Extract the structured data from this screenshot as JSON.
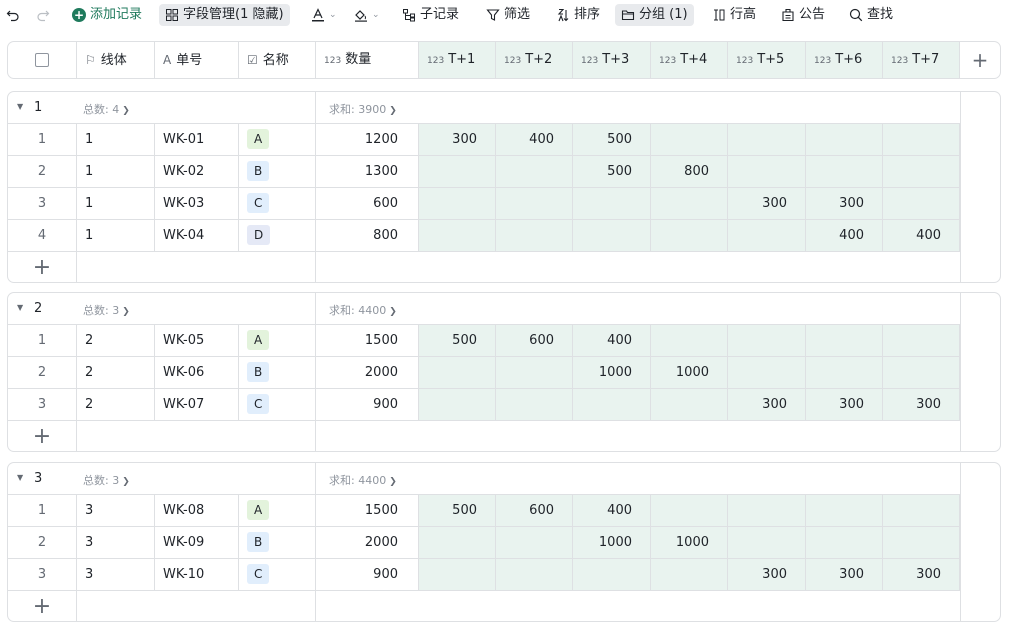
{
  "toolbar": {
    "undo_icon": "undo-icon",
    "redo_icon": "redo-icon",
    "add_record": "添加记录",
    "field_manage": "字段管理(1 隐藏)",
    "sub_record": "子记录",
    "filter": "筛选",
    "sort": "排序",
    "group": "分组 (1)",
    "row_height": "行高",
    "notice": "公告",
    "search": "查找"
  },
  "columns": {
    "line": "线体",
    "order_no": "单号",
    "name": "名称",
    "qty": "数量",
    "num_prefix": "123",
    "t1": "T+1",
    "t2": "T+2",
    "t3": "T+3",
    "t4": "T+4",
    "t5": "T+5",
    "t6": "T+6",
    "t7": "T+7"
  },
  "colors": {
    "accent_green": "#1f7a5c",
    "tinted_bg": "#e9f3ef",
    "tag_A": "#e3f3dc",
    "tag_B": "#e1eefc",
    "tag_C": "#e1eefc",
    "tag_D": "#e5e9f6"
  },
  "groups": [
    {
      "label": "1",
      "count": "总数: 4",
      "sum": "求和: 3900",
      "rows": [
        {
          "idx": "1",
          "line": "1",
          "order": "WK-01",
          "name": "A",
          "qty": "1200",
          "t": [
            "300",
            "400",
            "500",
            "",
            "",
            "",
            ""
          ]
        },
        {
          "idx": "2",
          "line": "1",
          "order": "WK-02",
          "name": "B",
          "qty": "1300",
          "t": [
            "",
            "",
            "500",
            "800",
            "",
            "",
            ""
          ]
        },
        {
          "idx": "3",
          "line": "1",
          "order": "WK-03",
          "name": "C",
          "qty": "600",
          "t": [
            "",
            "",
            "",
            "",
            "300",
            "300",
            ""
          ]
        },
        {
          "idx": "4",
          "line": "1",
          "order": "WK-04",
          "name": "D",
          "qty": "800",
          "t": [
            "",
            "",
            "",
            "",
            "",
            "400",
            "400"
          ]
        }
      ]
    },
    {
      "label": "2",
      "count": "总数: 3",
      "sum": "求和: 4400",
      "rows": [
        {
          "idx": "1",
          "line": "2",
          "order": "WK-05",
          "name": "A",
          "qty": "1500",
          "t": [
            "500",
            "600",
            "400",
            "",
            "",
            "",
            ""
          ]
        },
        {
          "idx": "2",
          "line": "2",
          "order": "WK-06",
          "name": "B",
          "qty": "2000",
          "t": [
            "",
            "",
            "1000",
            "1000",
            "",
            "",
            ""
          ]
        },
        {
          "idx": "3",
          "line": "2",
          "order": "WK-07",
          "name": "C",
          "qty": "900",
          "t": [
            "",
            "",
            "",
            "",
            "300",
            "300",
            "300"
          ]
        }
      ]
    },
    {
      "label": "3",
      "count": "总数: 3",
      "sum": "求和: 4400",
      "rows": [
        {
          "idx": "1",
          "line": "3",
          "order": "WK-08",
          "name": "A",
          "qty": "1500",
          "t": [
            "500",
            "600",
            "400",
            "",
            "",
            "",
            ""
          ]
        },
        {
          "idx": "2",
          "line": "3",
          "order": "WK-09",
          "name": "B",
          "qty": "2000",
          "t": [
            "",
            "",
            "1000",
            "1000",
            "",
            "",
            ""
          ]
        },
        {
          "idx": "3",
          "line": "3",
          "order": "WK-10",
          "name": "C",
          "qty": "900",
          "t": [
            "",
            "",
            "",
            "",
            "300",
            "300",
            "300"
          ]
        }
      ]
    }
  ]
}
